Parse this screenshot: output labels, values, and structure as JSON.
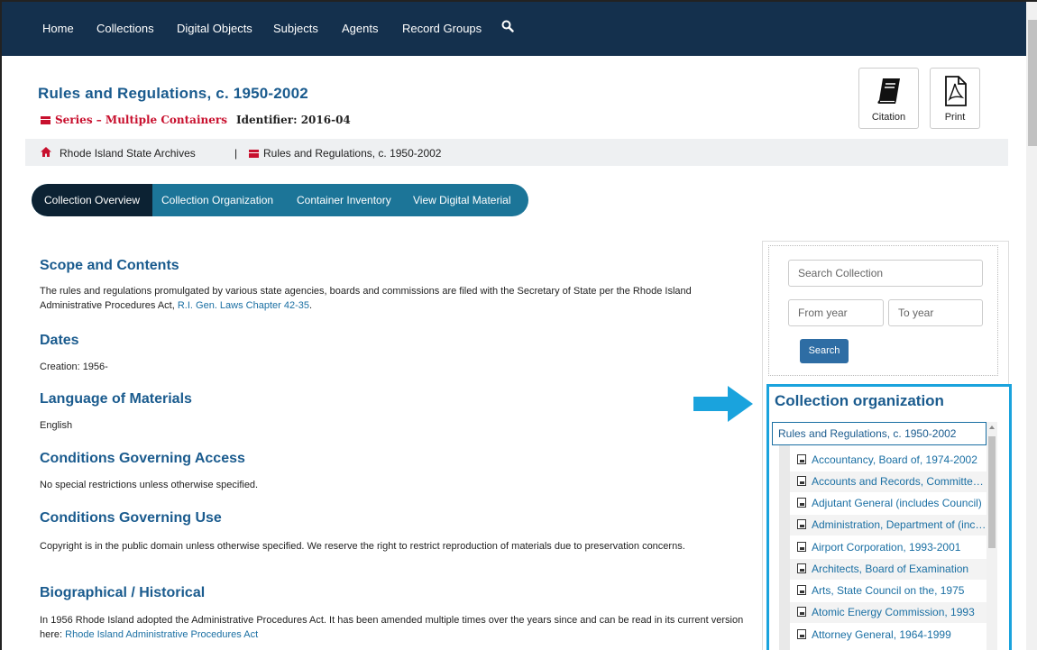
{
  "nav": {
    "items": [
      "Home",
      "Collections",
      "Digital Objects",
      "Subjects",
      "Agents",
      "Record Groups"
    ],
    "search_icon": "search-icon"
  },
  "record": {
    "title": "Rules and Regulations, c. 1950-2002",
    "level": "Series – Multiple Containers",
    "identifier": "Identifier: 2016-04"
  },
  "actions": {
    "citation": "Citation",
    "print": "Print"
  },
  "breadcrumb": {
    "repository": "Rhode Island State Archives",
    "separator": "|",
    "current": "Rules and Regulations, c. 1950-2002"
  },
  "tabs": [
    "Collection Overview",
    "Collection Organization",
    "Container Inventory",
    "View Digital Material"
  ],
  "sections": {
    "scope_heading": "Scope and Contents",
    "scope_text": "The rules and regulations promulgated by various state agencies, boards and commissions are filed with the Secretary of State per the Rhode Island Administrative Procedures Act,",
    "scope_link": "R.I. Gen. Laws Chapter 42-35",
    "scope_end": ".",
    "dates_heading": "Dates",
    "dates_text": "Creation: 1956-",
    "lang_heading": "Language of Materials",
    "lang_text": "English",
    "access_heading": "Conditions Governing Access",
    "access_text": "No special restrictions unless otherwise specified.",
    "use_heading": "Conditions Governing Use",
    "use_text": "Copyright is in the public domain unless otherwise specified. We reserve the right to restrict reproduction of materials due to preservation concerns.",
    "bio_heading": "Biographical / Historical",
    "bio_text": "In 1956 Rhode Island adopted the Administrative Procedures Act. It has been amended multiple times over the years since and can be read in its current version here:",
    "bio_link": "Rhode Island Administrative Procedures Act"
  },
  "sidebar": {
    "search_placeholder": "Search Collection",
    "from_placeholder": "From year",
    "to_placeholder": "To year",
    "search_button": "Search",
    "org_title": "Collection organization",
    "tree_root": "Rules and Regulations, c. 1950-2002",
    "tree_items": [
      "Accountancy, Board of, 1974-2002",
      "Accounts and Records, Committee on",
      "Adjutant General (includes Council)",
      "Administration, Department of (includes)",
      "Airport Corporation, 1993-2001",
      "Architects, Board of Examination",
      "Arts, State Council on the, 1975",
      "Atomic Energy Commission, 1993",
      "Attorney General, 1964-1999"
    ]
  },
  "colors": {
    "nav_bg": "#14304d",
    "title": "#1a5b8e",
    "accent_red": "#c8102e",
    "tab_bg": "#1c7598",
    "tab_active": "#0c2233",
    "highlight": "#1aa3dd"
  }
}
